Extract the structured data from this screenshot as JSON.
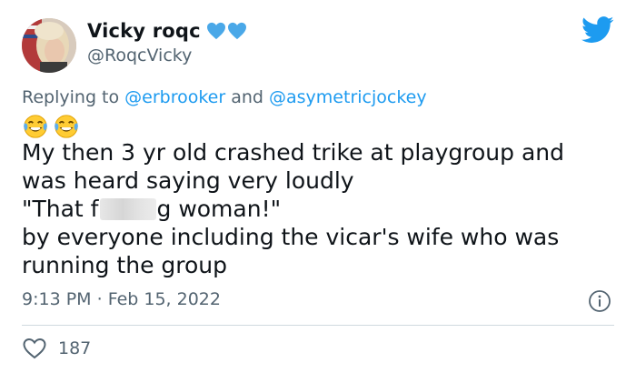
{
  "user": {
    "display_name": "Vicky roqc",
    "handle": "@RoqcVicky",
    "heart_color": "#4aa8e8"
  },
  "reply": {
    "prefix": "Replying to ",
    "mention_1": "@erbrooker",
    "conjunction": " and ",
    "mention_2": "@asymetricjockey"
  },
  "emoji": [
    "face-with-tears-of-joy-emoji",
    "face-with-tears-of-joy-emoji"
  ],
  "body": {
    "line1": "My then 3 yr old crashed trike at playgroup and",
    "line2": "was heard saying very loudly",
    "line3_before": "\"That f",
    "line3_after": "g woman!\"",
    "line4": "by everyone including the vicar's wife who was",
    "line5": "running the group"
  },
  "meta": {
    "time": "9:13 PM",
    "separator": " · ",
    "date": "Feb 15, 2022"
  },
  "likes": {
    "count": "187"
  },
  "colors": {
    "brand": "#1d9bf0",
    "secondary_text": "#536471",
    "primary_text": "#0f1419",
    "divider": "#cfd9de"
  }
}
